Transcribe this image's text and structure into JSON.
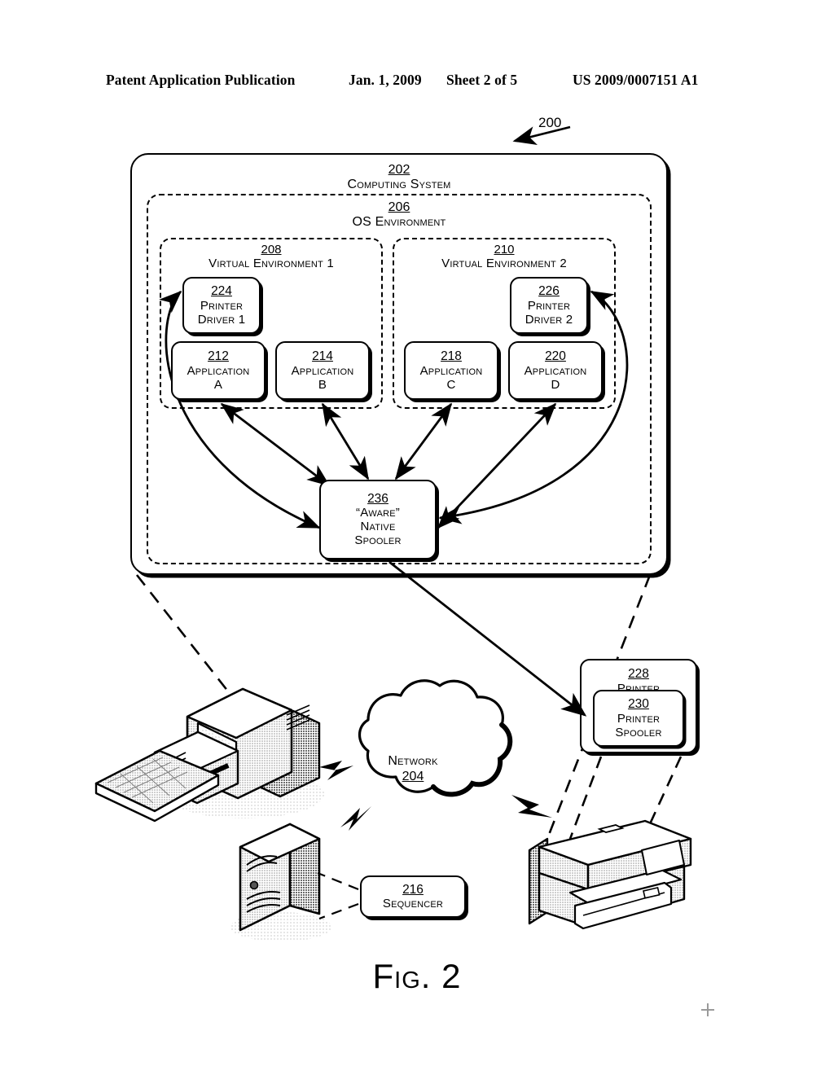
{
  "header": {
    "publication": "Patent Application Publication",
    "date": "Jan. 1, 2009",
    "sheet": "Sheet 2 of 5",
    "patent_number": "US 2009/0007151 A1"
  },
  "figure": {
    "caption": "Fig. 2",
    "callout_ref": "200"
  },
  "computing_system": {
    "ref": "202",
    "label": "Computing System"
  },
  "os_environment": {
    "ref": "206",
    "label": "OS Environment"
  },
  "virtual_environments": [
    {
      "ref": "208",
      "label": "Virtual Environment 1"
    },
    {
      "ref": "210",
      "label": "Virtual Environment 2"
    }
  ],
  "printer_drivers": [
    {
      "ref": "224",
      "line1": "Printer",
      "line2": "Driver 1"
    },
    {
      "ref": "226",
      "line1": "Printer",
      "line2": "Driver 2"
    }
  ],
  "applications": [
    {
      "ref": "212",
      "line1": "Application",
      "line2": "A"
    },
    {
      "ref": "214",
      "line1": "Application",
      "line2": "B"
    },
    {
      "ref": "218",
      "line1": "Application",
      "line2": "C"
    },
    {
      "ref": "220",
      "line1": "Application",
      "line2": "D"
    }
  ],
  "native_spooler": {
    "ref": "236",
    "line1": "“Aware”",
    "line2": "Native",
    "line3": "Spooler"
  },
  "printer": {
    "ref": "228",
    "label": "Printer",
    "spooler": {
      "ref": "230",
      "line1": "Printer",
      "line2": "Spooler"
    }
  },
  "network": {
    "label": "Network",
    "ref": "204"
  },
  "sequencer": {
    "ref": "216",
    "label": "Sequencer"
  },
  "illustrations": {
    "workstation": "desktop-computer-illustration",
    "server": "server-tower-illustration",
    "printer_device": "printer-device-illustration"
  },
  "colors": {
    "ink": "#000000",
    "paper": "#ffffff",
    "shade": "#b5b5b5"
  }
}
